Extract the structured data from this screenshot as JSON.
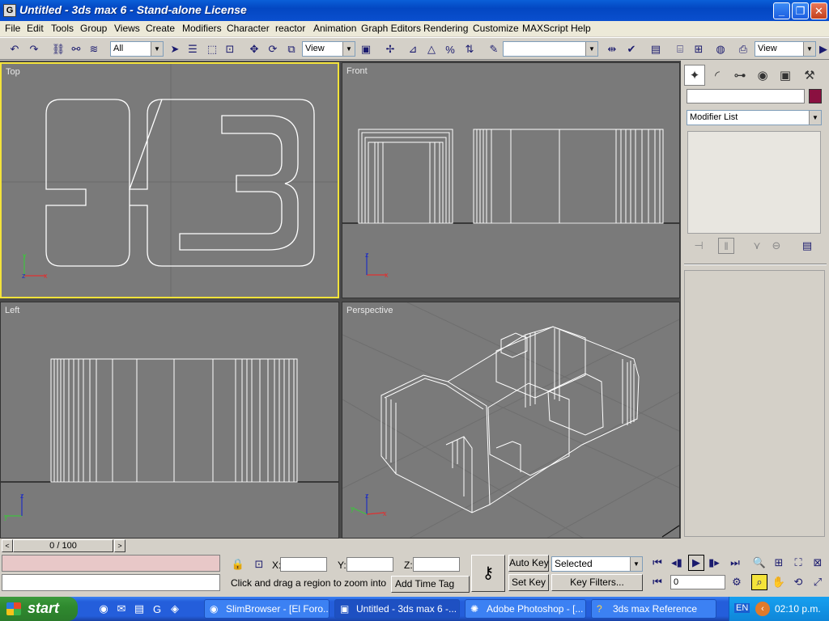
{
  "window": {
    "title": "Untitled - 3ds max 6 - Stand-alone License",
    "app_icon": "G"
  },
  "menu": [
    "File",
    "Edit",
    "Tools",
    "Group",
    "Views",
    "Create",
    "Modifiers",
    "Character",
    "reactor",
    "Animation",
    "Graph Editors",
    "Rendering",
    "Customize",
    "MAXScript",
    "Help"
  ],
  "toolbar": {
    "selection_filter": "All",
    "ref_coord": "View",
    "named_selection": "",
    "render_type": "View"
  },
  "viewports": {
    "top": "Top",
    "front": "Front",
    "left": "Left",
    "perspective": "Perspective"
  },
  "command_panel": {
    "object_name": "",
    "object_color": "#8a1040",
    "modifier_list": "Modifier List"
  },
  "timeline": {
    "slider": "0 / 100"
  },
  "status": {
    "x_label": "X:",
    "y_label": "Y:",
    "z_label": "Z:",
    "prompt": "Click and drag a region to zoom into",
    "add_time_tag": "Add Time Tag",
    "auto_key": "Auto Key",
    "set_key": "Set Key",
    "key_mode": "Selected",
    "key_filters": "Key Filters...",
    "frame": "0"
  },
  "taskbar": {
    "start": "start",
    "tasks": [
      "SlimBrowser - [El Foro...",
      "Untitled - 3ds max 6 -...",
      "Adobe Photoshop - [...",
      "3ds max Reference"
    ],
    "lang": "EN",
    "clock": "02:10 p.m."
  }
}
